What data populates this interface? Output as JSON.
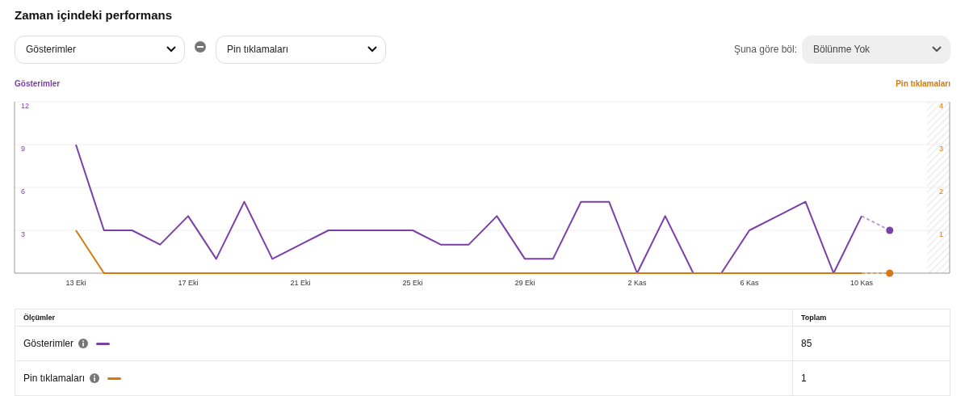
{
  "title": "Zaman içindeki performans",
  "metric_selects": [
    {
      "value": "Gösterimler"
    },
    {
      "value": "Pin tıklamaları"
    }
  ],
  "split": {
    "label": "Şuna göre böl:",
    "value": "Bölünme Yok"
  },
  "chart": {
    "chart_data": {
      "type": "line",
      "grid": true,
      "categories": [
        "13 Eki",
        null,
        null,
        null,
        "17 Eki",
        null,
        null,
        null,
        "21 Eki",
        null,
        null,
        null,
        "25 Eki",
        null,
        null,
        null,
        "29 Eki",
        null,
        null,
        null,
        "2 Kas",
        null,
        null,
        null,
        "6 Kas",
        null,
        null,
        null,
        "10 Kas",
        null
      ],
      "ylim": [
        0,
        12
      ],
      "yticks": [
        {
          "value": 3,
          "label": "3"
        },
        {
          "value": 6,
          "label": "6"
        },
        {
          "value": 9,
          "label": "9"
        },
        {
          "value": 12,
          "label": "12"
        }
      ],
      "y2lim": [
        0,
        4
      ],
      "y2ticks": [
        {
          "value": 1,
          "label": "1"
        },
        {
          "value": 2,
          "label": "2"
        },
        {
          "value": 3,
          "label": "3"
        },
        {
          "value": 4,
          "label": "4"
        }
      ],
      "series": [
        {
          "name": "Gösterimler",
          "color": "#7b3fa8",
          "values": [
            9,
            3,
            3,
            2,
            4,
            1,
            5,
            1,
            2,
            3,
            3,
            3,
            3,
            2,
            2,
            4,
            1,
            1,
            5,
            5,
            0,
            4,
            0,
            0,
            3,
            4,
            5,
            0,
            4,
            3
          ]
        },
        {
          "name": "Pin tıklamaları",
          "color": "#d9780e",
          "axis": "y2",
          "values": [
            1,
            0,
            0,
            0,
            0,
            0,
            0,
            0,
            0,
            0,
            0,
            0,
            0,
            0,
            0,
            0,
            0,
            0,
            0,
            0,
            0,
            0,
            0,
            0,
            0,
            0,
            0,
            0,
            0,
            0
          ]
        }
      ]
    }
  },
  "table": {
    "columns": [
      "Ölçümler",
      "Toplam"
    ],
    "rows": [
      {
        "metric": "Gösterimler",
        "color": "#7b3fa8",
        "total": "85"
      },
      {
        "metric": "Pin tıklamaları",
        "color": "#d9780e",
        "total": "1"
      }
    ]
  }
}
